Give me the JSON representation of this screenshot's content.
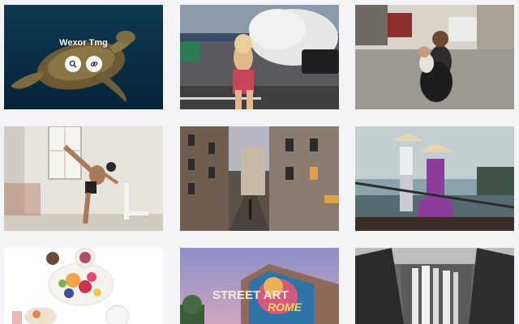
{
  "gallery": {
    "hovered_item": {
      "title": "Wexor Tmg",
      "actions": [
        {
          "name": "search-icon"
        },
        {
          "name": "link-icon"
        }
      ]
    },
    "items": [
      {
        "subject": "sea turtle underwater"
      },
      {
        "subject": "woman on racetrack with smoke"
      },
      {
        "subject": "mother and child on cobblestone street"
      },
      {
        "subject": "dancer high kick in white room"
      },
      {
        "subject": "city street between buildings"
      },
      {
        "subject": "women in conical hats on boat"
      },
      {
        "subject": "breakfast food on white table"
      },
      {
        "subject": "street art mural"
      },
      {
        "subject": "black and white waterfall"
      }
    ],
    "mural_text": {
      "line1": "STREET ART",
      "line2": "ROME"
    }
  },
  "colors": {
    "background": "#f4f4f6",
    "overlay_button": "#ffffff"
  }
}
